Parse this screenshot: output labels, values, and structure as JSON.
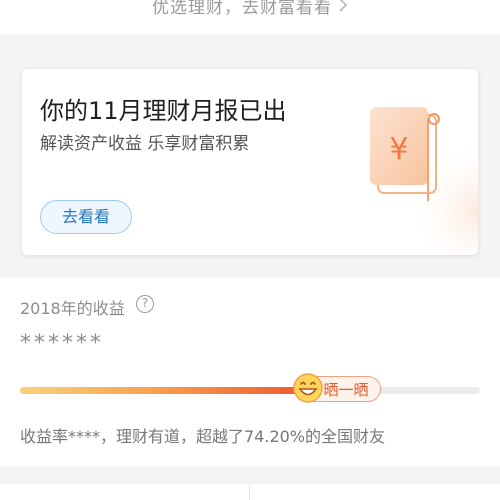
{
  "top": {
    "link_text": "优选理财，去财富看看",
    "chevron_icon": "chevron-right-icon"
  },
  "report_card": {
    "title": "你的11月理财月报已出",
    "subtitle": "解读资产收益 乐享财富积累",
    "button_label": "去看看",
    "illustration_icon": "yen-document-icon",
    "illustration_symbol": "¥"
  },
  "earnings": {
    "year_label": "2018年的收益",
    "help_icon": "question-circle-icon",
    "help_glyph": "?",
    "masked_value": "******",
    "progress_fraction": 0.74,
    "share_label": "晒一晒",
    "share_icon": "grinning-face-icon",
    "rate_text": "收益率****，理财有道，超越了74.20%的全国财友"
  },
  "colors": {
    "accent_blue": "#2a78c4",
    "accent_orange": "#e4572c",
    "progress_start": "#f9d27a",
    "progress_end": "#ef5a2b"
  }
}
